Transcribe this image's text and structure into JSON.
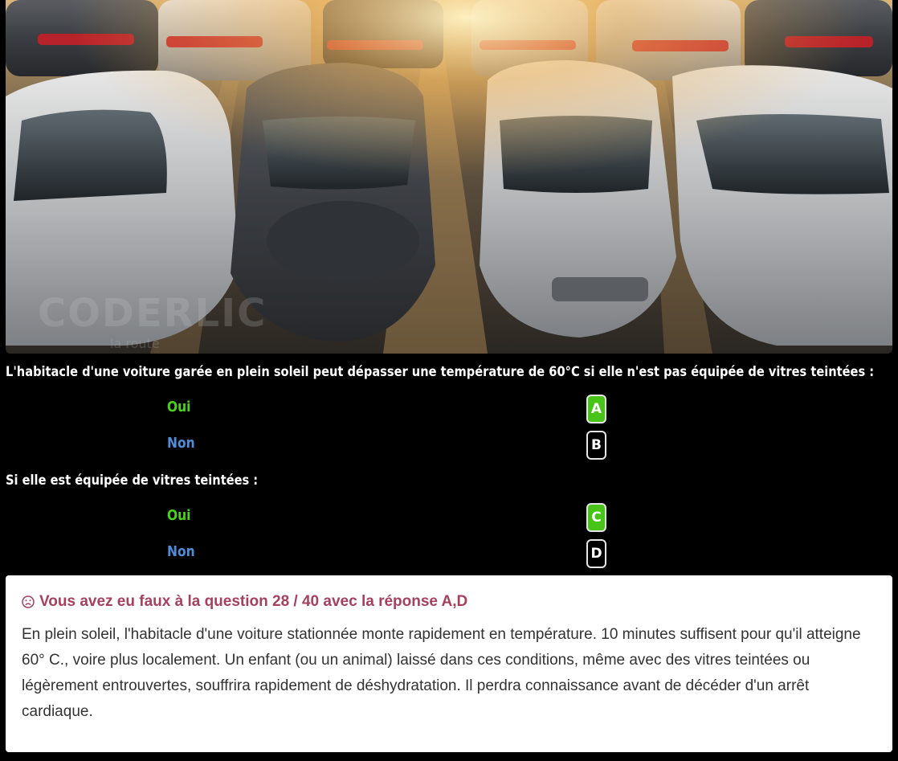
{
  "photo": {
    "description_icon": "parked-cars-photo",
    "watermark": "CODERLIC",
    "watermark_sub": "la route"
  },
  "question_1": {
    "text": "L'habitacle d'une voiture garée en plein soleil peut dépasser une température de 60°C si elle n'est pas équipée de vitres teintées :",
    "answers": [
      {
        "label": "Oui",
        "letter": "A",
        "selected": true
      },
      {
        "label": "Non",
        "letter": "B",
        "selected": false
      }
    ]
  },
  "question_2": {
    "text": "Si elle est équipée de vitres teintées :",
    "answers": [
      {
        "label": "Oui",
        "letter": "C",
        "selected": true
      },
      {
        "label": "Non",
        "letter": "D",
        "selected": false
      }
    ]
  },
  "feedback": {
    "icon": "sad-face-icon",
    "title": "Vous avez eu faux à la question 28 / 40 avec la réponse A,D",
    "explanation": "En plein soleil, l'habitacle d'une voiture stationnée monte rapidement en température. 10 minutes suffisent pour qu'il atteigne 60° C., voire plus localement. Un enfant (ou un animal) laissé dans ces conditions, même avec des vitres teintées ou légèrement entrouvertes, souffrira rapidement de déshydratation. Il perdra connaissance avant de décéder d'un arrêt cardiaque."
  },
  "colors": {
    "correct_green": "#49d319",
    "no_blue": "#4f8ddb",
    "selected_badge": "#48c419",
    "error_title": "#a5405f"
  }
}
